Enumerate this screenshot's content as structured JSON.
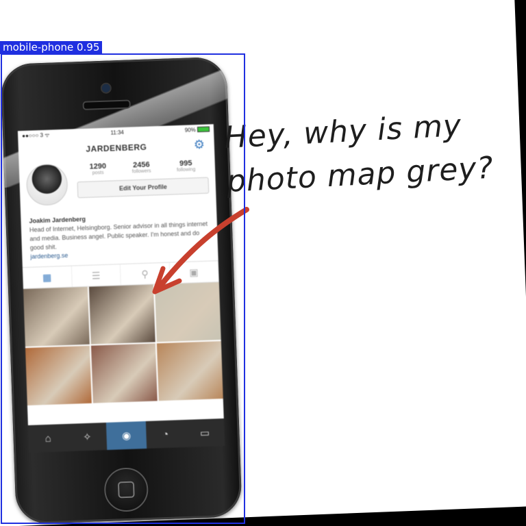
{
  "annotation": {
    "label": "mobile-phone 0.95",
    "color": "#1f2fe0"
  },
  "handwriting": {
    "line1": "Hey, why is my",
    "line2": "photo map grey?"
  },
  "phone_screen": {
    "status": {
      "carrier": "●●○○○ 3 ᯤ",
      "time": "11:34",
      "battery": "90%"
    },
    "header_title": "JARDENBERG",
    "stats": [
      {
        "value": "1290",
        "label": "posts"
      },
      {
        "value": "2456",
        "label": "followers"
      },
      {
        "value": "995",
        "label": "following"
      }
    ],
    "edit_button": "Edit Your Profile",
    "bio": {
      "name": "Joakim Jardenberg",
      "text": "Head of Internet, Helsingborg. Senior advisor in all things internet and media. Business angel. Public speaker. I'm honest and do good shit.",
      "link": "jardenberg.se"
    },
    "tabs": [
      {
        "icon": "grid-icon",
        "glyph": "▦",
        "active": true
      },
      {
        "icon": "list-icon",
        "glyph": "☰",
        "active": false
      },
      {
        "icon": "map-pin-icon",
        "glyph": "⚲",
        "active": false
      },
      {
        "icon": "tagged-user-icon",
        "glyph": "▣",
        "active": false
      }
    ],
    "photos": [
      "#7a6a5a",
      "#5a4a3e",
      "#c8c4b4",
      "#b06a3a",
      "#8a5a4a",
      "#b8865a"
    ],
    "bottom_nav": [
      {
        "icon": "home-icon",
        "glyph": "⌂"
      },
      {
        "icon": "explore-icon",
        "glyph": "✧"
      },
      {
        "icon": "camera-icon",
        "glyph": "◉"
      },
      {
        "icon": "activity-icon",
        "glyph": "◔"
      },
      {
        "icon": "profile-icon",
        "glyph": "▭"
      }
    ]
  },
  "colors": {
    "arrow": "#c8402e",
    "accent": "#3b7bbf"
  }
}
